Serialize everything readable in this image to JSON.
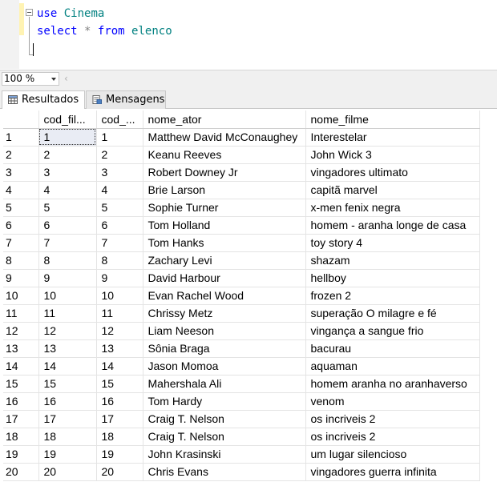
{
  "editor": {
    "line1": {
      "kw": "use",
      "id": "Cinema"
    },
    "line2": {
      "kw1": "select",
      "op": "*",
      "kw2": "from",
      "id": "elenco"
    }
  },
  "zoom": {
    "value": "100 %"
  },
  "tabs": [
    {
      "label": "Resultados",
      "icon": "grid-icon"
    },
    {
      "label": "Mensagens",
      "icon": "messages-icon"
    }
  ],
  "grid": {
    "columns": [
      "cod_fil...",
      "cod_...",
      "nome_ator",
      "nome_filme"
    ],
    "rows": [
      [
        "1",
        "1",
        "1",
        "Matthew David McConaughey",
        "Interestelar"
      ],
      [
        "2",
        "2",
        "2",
        "Keanu Reeves",
        "John Wick 3"
      ],
      [
        "3",
        "3",
        "3",
        "Robert Downey Jr",
        "vingadores ultimato"
      ],
      [
        "4",
        "4",
        "4",
        "Brie Larson",
        "capitã marvel"
      ],
      [
        "5",
        "5",
        "5",
        "Sophie Turner",
        "x-men fenix negra"
      ],
      [
        "6",
        "6",
        "6",
        "Tom Holland",
        "homem - aranha longe de casa"
      ],
      [
        "7",
        "7",
        "7",
        "Tom Hanks",
        "toy story 4"
      ],
      [
        "8",
        "8",
        "8",
        "Zachary Levi",
        "shazam"
      ],
      [
        "9",
        "9",
        "9",
        "David Harbour",
        "hellboy"
      ],
      [
        "10",
        "10",
        "10",
        "Evan Rachel Wood",
        "frozen 2"
      ],
      [
        "11",
        "11",
        "11",
        "Chrissy Metz",
        "superação O milagre e fé"
      ],
      [
        "12",
        "12",
        "12",
        "Liam Neeson",
        "vingança a sangue frio"
      ],
      [
        "13",
        "13",
        "13",
        "Sônia Braga",
        "bacurau"
      ],
      [
        "14",
        "14",
        "14",
        "Jason Momoa",
        "aquaman"
      ],
      [
        "15",
        "15",
        "15",
        "Mahershala Ali",
        "homem aranha no aranhaverso"
      ],
      [
        "16",
        "16",
        "16",
        "Tom Hardy",
        "venom"
      ],
      [
        "17",
        "17",
        "17",
        "Craig T. Nelson",
        "os incriveis 2"
      ],
      [
        "18",
        "18",
        "18",
        "Craig T. Nelson",
        "os incriveis 2"
      ],
      [
        "19",
        "19",
        "19",
        "John Krasinski",
        "um lugar silencioso"
      ],
      [
        "20",
        "20",
        "20",
        "Chris Evans",
        "vingadores guerra infinita"
      ]
    ]
  }
}
